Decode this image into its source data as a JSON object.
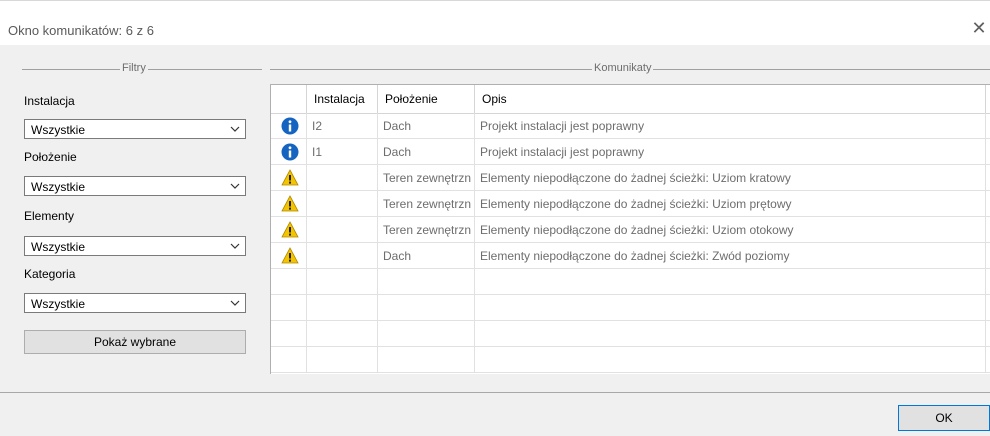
{
  "window": {
    "title": "Okno komunikatów: 6 z 6",
    "close_glyph": "✕"
  },
  "filters": {
    "group_title": "Filtry",
    "fields": [
      {
        "label": "Instalacja",
        "value": "Wszystkie"
      },
      {
        "label": "Położenie",
        "value": "Wszystkie"
      },
      {
        "label": "Elementy",
        "value": "Wszystkie"
      },
      {
        "label": "Kategoria",
        "value": "Wszystkie"
      }
    ],
    "apply_button": "Pokaż wybrane"
  },
  "messages": {
    "group_title": "Komunikaty",
    "columns": [
      "",
      "Instalacja",
      "Położenie",
      "Opis"
    ],
    "rows": [
      {
        "icon": "info-icon",
        "instalacja": "I2",
        "polozenie": "Dach",
        "opis": "Projekt instalacji jest poprawny"
      },
      {
        "icon": "info-icon",
        "instalacja": "I1",
        "polozenie": "Dach",
        "opis": "Projekt instalacji jest poprawny"
      },
      {
        "icon": "warning-icon",
        "instalacja": "",
        "polozenie": "Teren zewnętrzn",
        "opis": "Elementy niepodłączone do żadnej ścieżki: Uziom kratowy"
      },
      {
        "icon": "warning-icon",
        "instalacja": "",
        "polozenie": "Teren zewnętrzn",
        "opis": "Elementy niepodłączone do żadnej ścieżki: Uziom prętowy"
      },
      {
        "icon": "warning-icon",
        "instalacja": "",
        "polozenie": "Teren zewnętrzn",
        "opis": "Elementy niepodłączone do żadnej ścieżki: Uziom otokowy"
      },
      {
        "icon": "warning-icon",
        "instalacja": "",
        "polozenie": "Dach",
        "opis": "Elementy niepodłączone do żadnej ścieżki: Zwód poziomy"
      }
    ]
  },
  "footer": {
    "ok_button": "OK"
  },
  "colors": {
    "info": "#1565c0",
    "warning": "#f5c400",
    "accent_border": "#0078d7"
  }
}
